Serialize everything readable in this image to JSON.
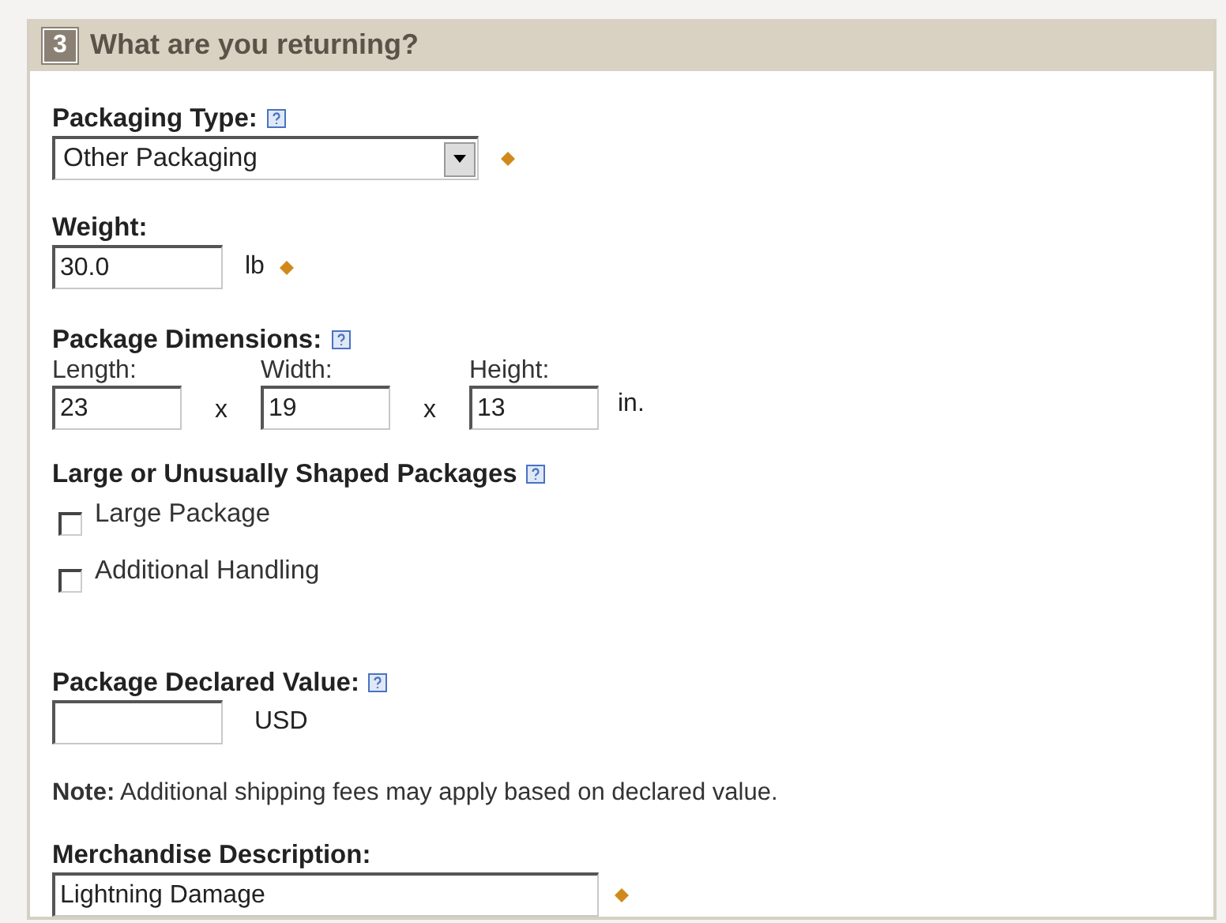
{
  "section": {
    "number": "3",
    "title": "What are you returning?"
  },
  "fields": [
    {
      "kind": "select",
      "label": "Packaging Type:",
      "help": true,
      "value": "Other Packaging",
      "required": true
    },
    {
      "kind": "input",
      "label": "Weight:",
      "value": "30.0",
      "unit": "lb",
      "required": true
    },
    {
      "kind": "dimensions",
      "label": "Package Dimensions:",
      "help": true,
      "parts": [
        {
          "label": "Length:",
          "value": "23"
        },
        {
          "label": "Width:",
          "value": "19",
          "separator": "x"
        },
        {
          "label": "Height:",
          "value": "13",
          "separator": "x"
        }
      ],
      "unit": "in."
    },
    {
      "kind": "checkboxes",
      "label": "Large or Unusually Shaped Packages",
      "help": true,
      "options": [
        {
          "label": "Large Package",
          "checked": false
        },
        {
          "label": "Additional Handling",
          "checked": false
        }
      ]
    },
    {
      "kind": "input",
      "label": "Package Declared Value:",
      "help": true,
      "unit": "USD"
    },
    {
      "kind": "note",
      "text": "**Note:** Additional shipping fees may apply based on declared value."
    },
    {
      "kind": "wide",
      "label": "Merchandise Description:",
      "value": "Lightning Damage",
      "required": true
    }
  ]
}
